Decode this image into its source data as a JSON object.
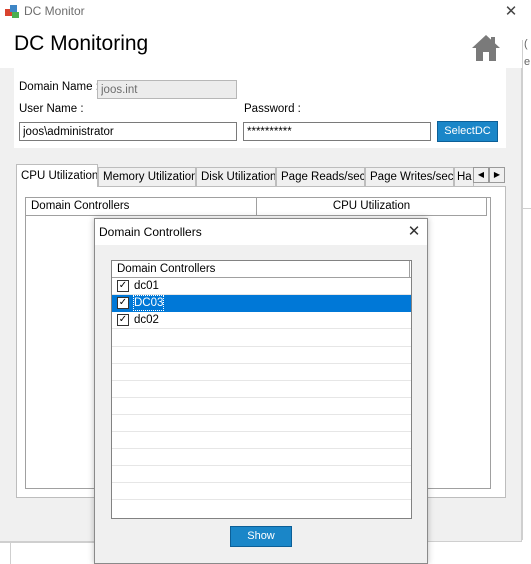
{
  "window": {
    "title": "DC Monitor",
    "heading": "DC Monitoring"
  },
  "form": {
    "domain_label": "Domain Name :",
    "domain_value": "joos.int",
    "user_label": "User Name :",
    "user_value": "joos\\administrator",
    "password_label": "Password :",
    "password_value": "**********",
    "select_dc_label": "SelectDC"
  },
  "tabs": [
    {
      "label": "CPU Utilization",
      "active": true
    },
    {
      "label": "Memory Utilization",
      "active": false
    },
    {
      "label": "Disk Utilization",
      "active": false
    },
    {
      "label": "Page Reads/sec",
      "active": false
    },
    {
      "label": "Page Writes/sec",
      "active": false
    },
    {
      "label": "Ha",
      "active": false
    }
  ],
  "grid": {
    "columns": [
      "Domain Controllers",
      "CPU Utilization"
    ]
  },
  "dialog": {
    "title": "Domain Controllers",
    "list_header": "Domain Controllers",
    "items": [
      {
        "label": "dc01",
        "checked": true,
        "selected": false
      },
      {
        "label": "DC03",
        "checked": true,
        "selected": true
      },
      {
        "label": "dc02",
        "checked": true,
        "selected": false
      }
    ],
    "show_label": "Show"
  },
  "colors": {
    "accent": "#1a86c8",
    "selection": "#0078d7"
  }
}
